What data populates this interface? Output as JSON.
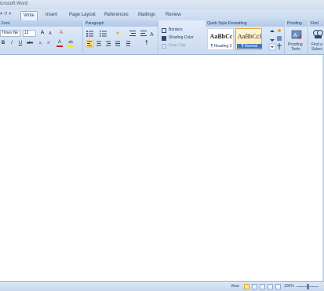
{
  "window": {
    "title": "icrosoft Word",
    "qat_label": "▾ ↺ ▾"
  },
  "tabs": [
    {
      "label": "Write"
    },
    {
      "label": "Insert"
    },
    {
      "label": "Page Layout"
    },
    {
      "label": "References"
    },
    {
      "label": "Mailings"
    },
    {
      "label": "Review"
    }
  ],
  "ribbon": {
    "font": {
      "header": "Font",
      "name": "Times Ne",
      "size": "12",
      "grow": "A",
      "shrink": "A",
      "clear": "A",
      "bold": "B",
      "italic": "I",
      "underline": "U",
      "strike": "abc",
      "sub": "x,",
      "sup": "x'",
      "color": "A",
      "highlight": "ab"
    },
    "paragraph": {
      "header": "Paragraph",
      "borders": "Borders",
      "shading": "Shading Color",
      "dropcap": "Drop Cap",
      "pilcrow": "¶"
    },
    "styles": {
      "header": "Quick Style Formatting",
      "items": [
        {
          "sample": "AaBbCc",
          "name": "¶ Heading 3"
        },
        {
          "sample": "AaBbCcI",
          "name": "¶ Normal"
        }
      ]
    },
    "proofing": {
      "header": "Proofing",
      "label1": "Proofing",
      "label2": "Tools"
    },
    "find": {
      "header": "Find",
      "label1": "Find a",
      "label2": "Select"
    }
  },
  "statusbar": {
    "view_label": "View",
    "zoom": "100%"
  },
  "colors": {
    "accent": "#3c77c9",
    "ribbon": "#d3e1f3",
    "selected": "#fbe6a6"
  }
}
